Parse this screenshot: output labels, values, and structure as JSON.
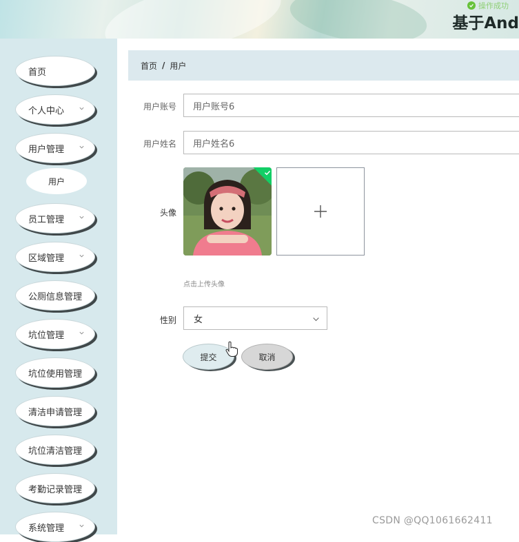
{
  "header": {
    "title": "基于And",
    "toast": "操作成功"
  },
  "sidebar": {
    "items": [
      {
        "label": "首页",
        "expandable": false
      },
      {
        "label": "个人中心",
        "expandable": true
      },
      {
        "label": "用户管理",
        "expandable": true,
        "children": [
          {
            "label": "用户"
          }
        ]
      },
      {
        "label": "员工管理",
        "expandable": true
      },
      {
        "label": "区域管理",
        "expandable": true
      },
      {
        "label": "公厕信息管理",
        "expandable": false
      },
      {
        "label": "坑位管理",
        "expandable": true
      },
      {
        "label": "坑位使用管理",
        "expandable": false
      },
      {
        "label": "清洁申请管理",
        "expandable": false
      },
      {
        "label": "坑位清洁管理",
        "expandable": false
      },
      {
        "label": "考勤记录管理",
        "expandable": false
      },
      {
        "label": "系统管理",
        "expandable": true
      }
    ]
  },
  "breadcrumb": {
    "home": "首页",
    "separator": "/",
    "current": "用户"
  },
  "form": {
    "account": {
      "label": "用户账号",
      "value": "用户账号6"
    },
    "name": {
      "label": "用户姓名",
      "value": "用户姓名6"
    },
    "avatar": {
      "label": "头像",
      "upload_tip": "点击上传头像",
      "uploaded": true
    },
    "gender": {
      "label": "性别",
      "value": "女"
    },
    "submit_label": "提交",
    "cancel_label": "取消"
  },
  "watermark": "CSDN @QQ1061662411",
  "colors": {
    "sidebar_bg": "#d7e9ed",
    "breadcrumb_bg": "#dce9ee",
    "success": "#13ce66"
  }
}
